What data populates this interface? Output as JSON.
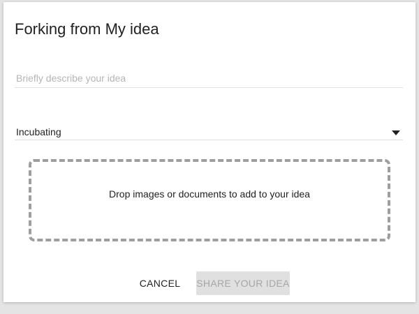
{
  "dialog": {
    "title": "Forking from My idea",
    "description": {
      "placeholder": "Briefly describe your idea",
      "value": ""
    },
    "stage_select": {
      "selected": "Incubating",
      "arrow_icon": "dropdown-arrow-icon"
    },
    "dropzone": {
      "text": "Drop images or documents to add to your idea"
    },
    "actions": {
      "cancel_label": "CANCEL",
      "share_label": "SHARE YOUR IDEA",
      "share_enabled": false
    }
  }
}
